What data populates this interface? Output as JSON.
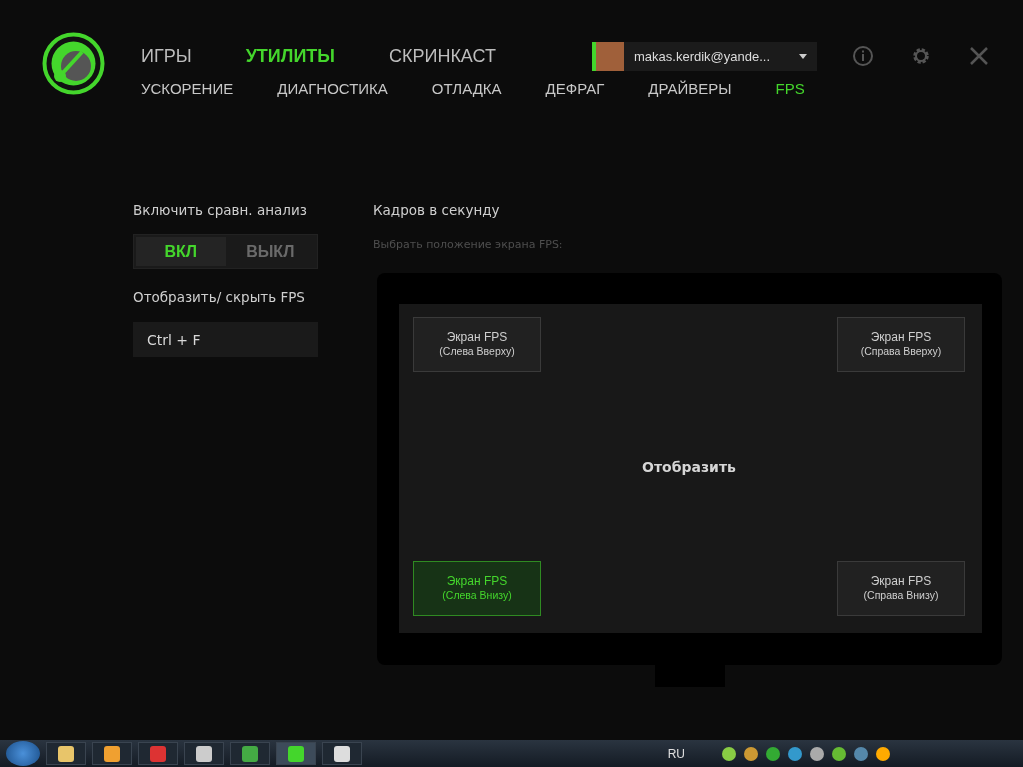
{
  "main_tabs": [
    {
      "label": "ИГРЫ",
      "selected": false
    },
    {
      "label": "УТИЛИТЫ",
      "selected": true
    },
    {
      "label": "СКРИНКАСТ",
      "selected": false
    }
  ],
  "sub_tabs": [
    {
      "label": "УСКОРЕНИЕ",
      "selected": false
    },
    {
      "label": "ДИАГНОСТИКА",
      "selected": false
    },
    {
      "label": "ОТЛАДКА",
      "selected": false
    },
    {
      "label": "ДЕФРАГ",
      "selected": false
    },
    {
      "label": "ДРАЙВЕРЫ",
      "selected": false
    },
    {
      "label": "FPS",
      "selected": true
    }
  ],
  "account": {
    "email": "makas.kerdik@yande..."
  },
  "benchmark": {
    "label": "Включить сравн. анализ",
    "options": [
      {
        "label": "ВКЛ",
        "selected": true
      },
      {
        "label": "ВЫКЛ",
        "selected": false
      }
    ]
  },
  "hotkey": {
    "label": "Отобразить/ скрыть FPS",
    "value": "Ctrl + F"
  },
  "fps": {
    "title": "Кадров в секунду",
    "hint": "Выбрать положение экрана FPS:",
    "center_label": "Отобразить",
    "positions": [
      {
        "label": "Экран FPS",
        "sub": "(Слева Вверху)",
        "selected": false
      },
      {
        "label": "Экран FPS",
        "sub": "(Справа Вверху)",
        "selected": false
      },
      {
        "label": "Экран FPS",
        "sub": "(Слева Внизу)",
        "selected": true
      },
      {
        "label": "Экран FPS",
        "sub": "(Справа Внизу)",
        "selected": false
      }
    ]
  },
  "taskbar": {
    "language": "RU"
  }
}
